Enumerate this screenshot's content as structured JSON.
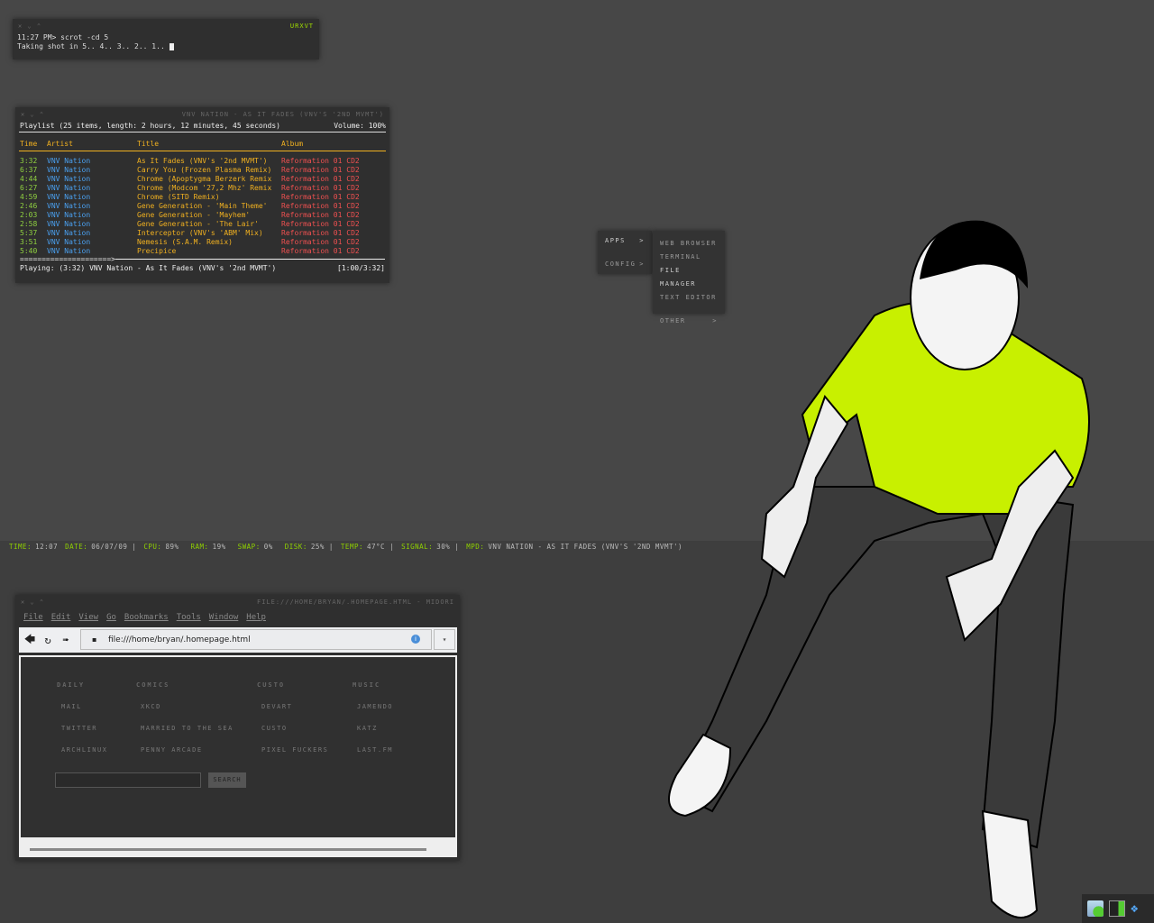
{
  "terminal": {
    "title": "URXVT",
    "prompt": "11:27 PM> scrot -cd 5",
    "output": "Taking shot in 5.. 4.. 3.. 2.. 1.. "
  },
  "ncmpcpp": {
    "title": "VNV NATION - AS IT FADES (VNV'S '2ND MVMT')",
    "summary": "Playlist (25 items, length: 2 hours, 12 minutes, 45 seconds)",
    "volume": "Volume: 100%",
    "columns": [
      "Time",
      "Artist",
      "Title",
      "Album"
    ],
    "rows": [
      [
        "3:32",
        "VNV Nation",
        "As It Fades (VNV's '2nd MVMT')",
        "Reformation 01 CD2"
      ],
      [
        "6:37",
        "VNV Nation",
        "Carry You (Frozen Plasma Remix)",
        "Reformation 01 CD2"
      ],
      [
        "4:44",
        "VNV Nation",
        "Chrome (Apoptygma Berzerk Remix",
        "Reformation 01 CD2"
      ],
      [
        "6:27",
        "VNV Nation",
        "Chrome (Modcom '27,2 Mhz' Remix",
        "Reformation 01 CD2"
      ],
      [
        "4:59",
        "VNV Nation",
        "Chrome (SITD Remix)",
        "Reformation 01 CD2"
      ],
      [
        "2:46",
        "VNV Nation",
        "Gene Generation - 'Main Theme'",
        "Reformation 01 CD2"
      ],
      [
        "2:03",
        "VNV Nation",
        "Gene Generation - 'Mayhem'",
        "Reformation 01 CD2"
      ],
      [
        "2:58",
        "VNV Nation",
        "Gene Generation - 'The Lair'",
        "Reformation 01 CD2"
      ],
      [
        "5:37",
        "VNV Nation",
        "Interceptor (VNV's 'ABM' Mix)",
        "Reformation 01 CD2"
      ],
      [
        "3:51",
        "VNV Nation",
        "Nemesis (S.A.M. Remix)",
        "Reformation 01 CD2"
      ],
      [
        "5:40",
        "VNV Nation",
        "Precipice",
        "Reformation 01 CD2"
      ]
    ],
    "progress_bar": "=====================>",
    "progress": 0.283,
    "playing": "Playing: (3:32) VNV Nation - As It Fades (VNV's '2nd MVMT')",
    "elapsed": "[1:00/3:32]"
  },
  "statusbar": [
    [
      "TIME:",
      "12:07"
    ],
    [
      "DATE:",
      "06/07/09 |"
    ],
    [
      "CPU:",
      "89% "
    ],
    [
      "RAM:",
      "19% "
    ],
    [
      "SWAP:",
      "0% "
    ],
    [
      "DISK:",
      "25% |"
    ],
    [
      "TEMP:",
      "47°C |"
    ],
    [
      "SIGNAL:",
      "30% |"
    ],
    [
      "MPD:",
      "VNV NATION - AS IT FADES (VNV'S '2ND MVMT')"
    ]
  ],
  "menu": {
    "root": [
      {
        "label": "APPS",
        "arrow": ">"
      },
      {
        "label": "CONFIG",
        "arrow": ">"
      }
    ],
    "apps": [
      "WEB BROWSER",
      "TERMINAL",
      "FILE MANAGER",
      "TEXT EDITOR"
    ],
    "other": {
      "label": "OTHER",
      "arrow": ">"
    }
  },
  "browser": {
    "title": "FILE:///HOME/BRYAN/.HOMEPAGE.HTML - MIDORI",
    "menus": [
      "File",
      "Edit",
      "View",
      "Go",
      "Bookmarks",
      "Tools",
      "Window",
      "Help"
    ],
    "url": "file:///home/bryan/.homepage.html",
    "columns": [
      {
        "heading": "DAILY",
        "links": [
          "MAIL",
          "TWITTER",
          "ARCHLINUX"
        ]
      },
      {
        "heading": "COMICS",
        "links": [
          "XKCD",
          "MARRIED TO THE SEA",
          "PENNY ARCADE"
        ]
      },
      {
        "heading": "CUSTO",
        "links": [
          "DEVART",
          "CUSTO",
          "PIXEL FUCKERS"
        ]
      },
      {
        "heading": "MUSIC",
        "links": [
          "JAMENDO",
          "KATZ",
          "LAST.FM"
        ]
      }
    ],
    "search_button": "SEARCH",
    "search_value": ""
  },
  "colors": {
    "accent_green": "#9fdc00",
    "shirt": "#c8f000"
  }
}
